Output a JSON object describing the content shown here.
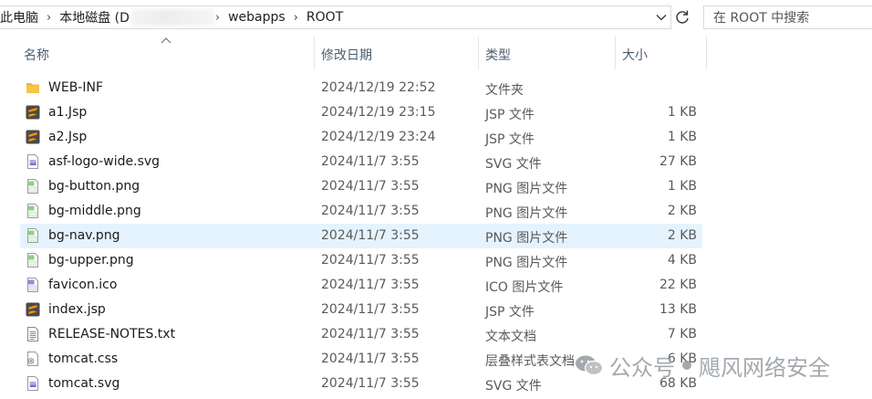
{
  "address_bar": {
    "crumbs": [
      "此电脑",
      "本地磁盘 (D",
      "webapps",
      "ROOT"
    ]
  },
  "search": {
    "placeholder": "在 ROOT 中搜索"
  },
  "columns": {
    "name": "名称",
    "date": "修改日期",
    "type": "类型",
    "size": "大小"
  },
  "files": [
    {
      "name": "WEB-INF",
      "date": "2024/12/19 22:52",
      "type": "文件夹",
      "size": "",
      "icon": "folder-icon"
    },
    {
      "name": "a1.Jsp",
      "date": "2024/12/19 23:15",
      "type": "JSP 文件",
      "size": "1 KB",
      "icon": "sublime-text-icon"
    },
    {
      "name": "a2.Jsp",
      "date": "2024/12/19 23:24",
      "type": "JSP 文件",
      "size": "1 KB",
      "icon": "sublime-text-icon"
    },
    {
      "name": "asf-logo-wide.svg",
      "date": "2024/11/7 3:55",
      "type": "SVG 文件",
      "size": "27 KB",
      "icon": "svg-file-icon"
    },
    {
      "name": "bg-button.png",
      "date": "2024/11/7 3:55",
      "type": "PNG 图片文件",
      "size": "1 KB",
      "icon": "png-image-icon"
    },
    {
      "name": "bg-middle.png",
      "date": "2024/11/7 3:55",
      "type": "PNG 图片文件",
      "size": "2 KB",
      "icon": "png-image-icon"
    },
    {
      "name": "bg-nav.png",
      "date": "2024/11/7 3:55",
      "type": "PNG 图片文件",
      "size": "2 KB",
      "icon": "png-image-icon",
      "selected": true
    },
    {
      "name": "bg-upper.png",
      "date": "2024/11/7 3:55",
      "type": "PNG 图片文件",
      "size": "4 KB",
      "icon": "png-image-icon"
    },
    {
      "name": "favicon.ico",
      "date": "2024/11/7 3:55",
      "type": "ICO 图片文件",
      "size": "22 KB",
      "icon": "ico-image-icon"
    },
    {
      "name": "index.jsp",
      "date": "2024/11/7 3:55",
      "type": "JSP 文件",
      "size": "13 KB",
      "icon": "sublime-text-icon"
    },
    {
      "name": "RELEASE-NOTES.txt",
      "date": "2024/11/7 3:55",
      "type": "文本文档",
      "size": "7 KB",
      "icon": "text-document-icon"
    },
    {
      "name": "tomcat.css",
      "date": "2024/11/7 3:55",
      "type": "层叠样式表文档",
      "size": "6 KB",
      "icon": "css-file-icon"
    },
    {
      "name": "tomcat.svg",
      "date": "2024/11/7 3:55",
      "type": "SVG 文件",
      "size": "68 KB",
      "icon": "svg-file-icon"
    }
  ],
  "watermark": {
    "left": "公众号",
    "right": "飓风网络安全"
  },
  "colors": {
    "selected_row": "#e5f3ff",
    "sublime_orange": "#f89406",
    "folder_yellow": "#f6c544"
  }
}
